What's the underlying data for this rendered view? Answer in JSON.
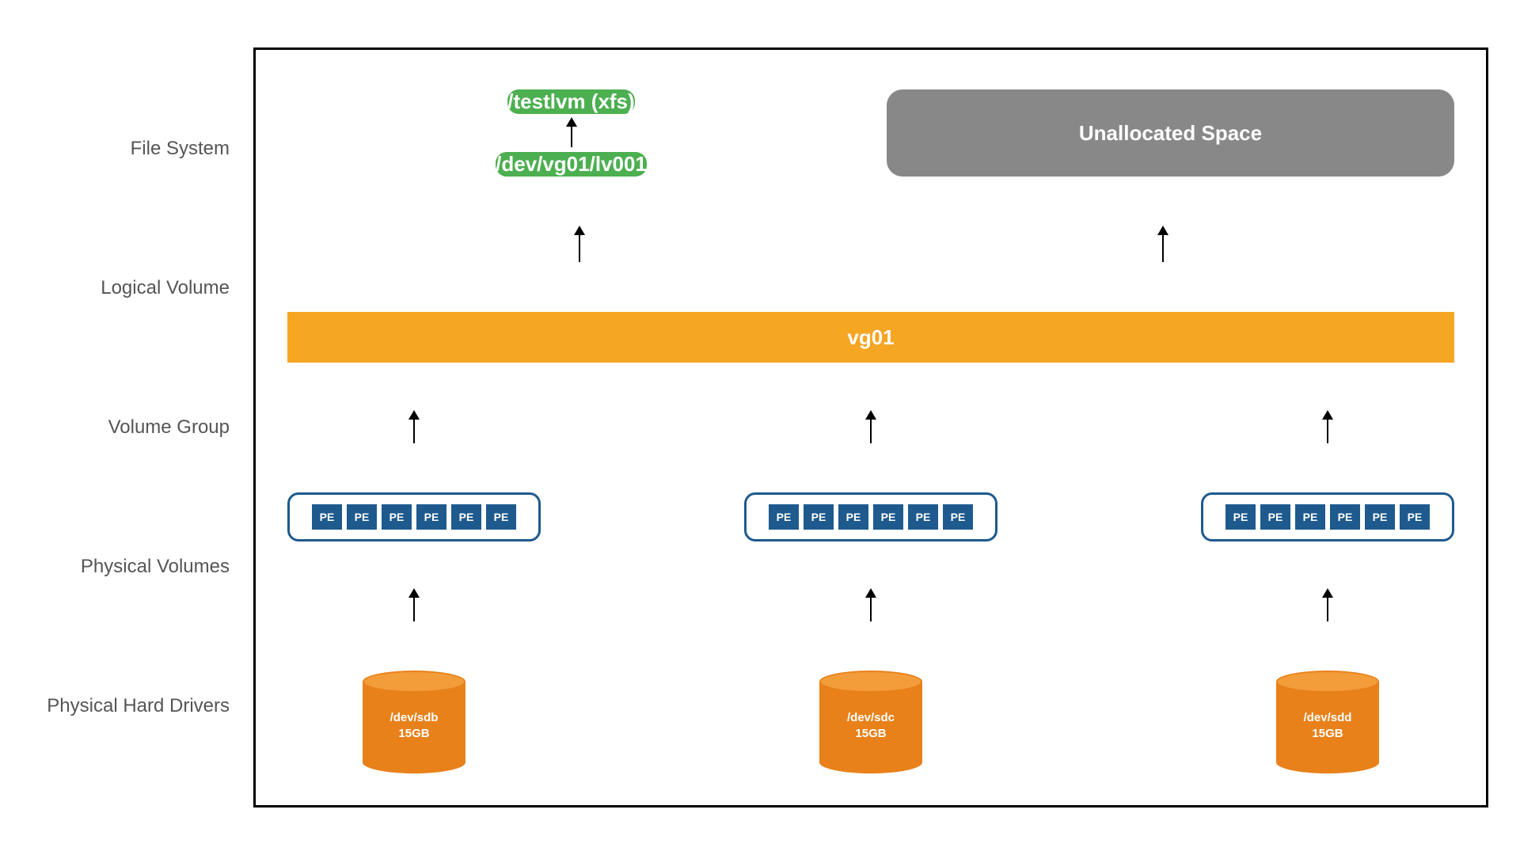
{
  "labels": {
    "fileSystem": "File System",
    "logicalVolume": "Logical Volume",
    "volumeGroup": "Volume Group",
    "physicalVolumes": "Physical Volumes",
    "physicalHardDrivers": "Physical Hard Drivers"
  },
  "fileSystem": {
    "mount": "/testlvm (xfs)"
  },
  "logicalVolume": {
    "path": "/dev/vg01/lv001"
  },
  "unallocated": "Unallocated Space",
  "volumeGroup": {
    "name": "vg01"
  },
  "physicalExtent": "PE",
  "disks": [
    {
      "dev": "/dev/sdb",
      "size": "15GB"
    },
    {
      "dev": "/dev/sdc",
      "size": "15GB"
    },
    {
      "dev": "/dev/sdd",
      "size": "15GB"
    }
  ]
}
